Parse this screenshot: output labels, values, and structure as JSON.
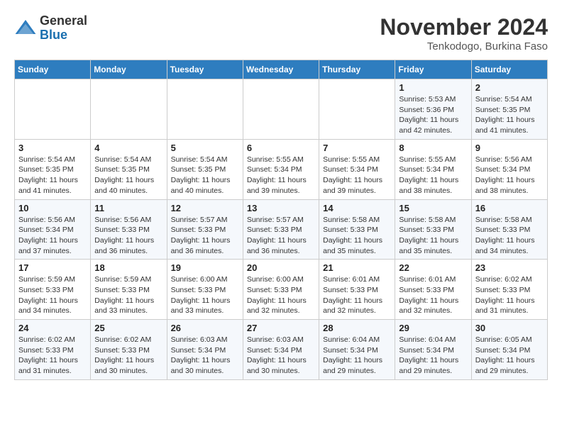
{
  "header": {
    "logo_general": "General",
    "logo_blue": "Blue",
    "month_title": "November 2024",
    "location": "Tenkodogo, Burkina Faso"
  },
  "weekdays": [
    "Sunday",
    "Monday",
    "Tuesday",
    "Wednesday",
    "Thursday",
    "Friday",
    "Saturday"
  ],
  "weeks": [
    [
      {
        "day": "",
        "info": ""
      },
      {
        "day": "",
        "info": ""
      },
      {
        "day": "",
        "info": ""
      },
      {
        "day": "",
        "info": ""
      },
      {
        "day": "",
        "info": ""
      },
      {
        "day": "1",
        "info": "Sunrise: 5:53 AM\nSunset: 5:36 PM\nDaylight: 11 hours\nand 42 minutes."
      },
      {
        "day": "2",
        "info": "Sunrise: 5:54 AM\nSunset: 5:35 PM\nDaylight: 11 hours\nand 41 minutes."
      }
    ],
    [
      {
        "day": "3",
        "info": "Sunrise: 5:54 AM\nSunset: 5:35 PM\nDaylight: 11 hours\nand 41 minutes."
      },
      {
        "day": "4",
        "info": "Sunrise: 5:54 AM\nSunset: 5:35 PM\nDaylight: 11 hours\nand 40 minutes."
      },
      {
        "day": "5",
        "info": "Sunrise: 5:54 AM\nSunset: 5:35 PM\nDaylight: 11 hours\nand 40 minutes."
      },
      {
        "day": "6",
        "info": "Sunrise: 5:55 AM\nSunset: 5:34 PM\nDaylight: 11 hours\nand 39 minutes."
      },
      {
        "day": "7",
        "info": "Sunrise: 5:55 AM\nSunset: 5:34 PM\nDaylight: 11 hours\nand 39 minutes."
      },
      {
        "day": "8",
        "info": "Sunrise: 5:55 AM\nSunset: 5:34 PM\nDaylight: 11 hours\nand 38 minutes."
      },
      {
        "day": "9",
        "info": "Sunrise: 5:56 AM\nSunset: 5:34 PM\nDaylight: 11 hours\nand 38 minutes."
      }
    ],
    [
      {
        "day": "10",
        "info": "Sunrise: 5:56 AM\nSunset: 5:34 PM\nDaylight: 11 hours\nand 37 minutes."
      },
      {
        "day": "11",
        "info": "Sunrise: 5:56 AM\nSunset: 5:33 PM\nDaylight: 11 hours\nand 36 minutes."
      },
      {
        "day": "12",
        "info": "Sunrise: 5:57 AM\nSunset: 5:33 PM\nDaylight: 11 hours\nand 36 minutes."
      },
      {
        "day": "13",
        "info": "Sunrise: 5:57 AM\nSunset: 5:33 PM\nDaylight: 11 hours\nand 36 minutes."
      },
      {
        "day": "14",
        "info": "Sunrise: 5:58 AM\nSunset: 5:33 PM\nDaylight: 11 hours\nand 35 minutes."
      },
      {
        "day": "15",
        "info": "Sunrise: 5:58 AM\nSunset: 5:33 PM\nDaylight: 11 hours\nand 35 minutes."
      },
      {
        "day": "16",
        "info": "Sunrise: 5:58 AM\nSunset: 5:33 PM\nDaylight: 11 hours\nand 34 minutes."
      }
    ],
    [
      {
        "day": "17",
        "info": "Sunrise: 5:59 AM\nSunset: 5:33 PM\nDaylight: 11 hours\nand 34 minutes."
      },
      {
        "day": "18",
        "info": "Sunrise: 5:59 AM\nSunset: 5:33 PM\nDaylight: 11 hours\nand 33 minutes."
      },
      {
        "day": "19",
        "info": "Sunrise: 6:00 AM\nSunset: 5:33 PM\nDaylight: 11 hours\nand 33 minutes."
      },
      {
        "day": "20",
        "info": "Sunrise: 6:00 AM\nSunset: 5:33 PM\nDaylight: 11 hours\nand 32 minutes."
      },
      {
        "day": "21",
        "info": "Sunrise: 6:01 AM\nSunset: 5:33 PM\nDaylight: 11 hours\nand 32 minutes."
      },
      {
        "day": "22",
        "info": "Sunrise: 6:01 AM\nSunset: 5:33 PM\nDaylight: 11 hours\nand 32 minutes."
      },
      {
        "day": "23",
        "info": "Sunrise: 6:02 AM\nSunset: 5:33 PM\nDaylight: 11 hours\nand 31 minutes."
      }
    ],
    [
      {
        "day": "24",
        "info": "Sunrise: 6:02 AM\nSunset: 5:33 PM\nDaylight: 11 hours\nand 31 minutes."
      },
      {
        "day": "25",
        "info": "Sunrise: 6:02 AM\nSunset: 5:33 PM\nDaylight: 11 hours\nand 30 minutes."
      },
      {
        "day": "26",
        "info": "Sunrise: 6:03 AM\nSunset: 5:34 PM\nDaylight: 11 hours\nand 30 minutes."
      },
      {
        "day": "27",
        "info": "Sunrise: 6:03 AM\nSunset: 5:34 PM\nDaylight: 11 hours\nand 30 minutes."
      },
      {
        "day": "28",
        "info": "Sunrise: 6:04 AM\nSunset: 5:34 PM\nDaylight: 11 hours\nand 29 minutes."
      },
      {
        "day": "29",
        "info": "Sunrise: 6:04 AM\nSunset: 5:34 PM\nDaylight: 11 hours\nand 29 minutes."
      },
      {
        "day": "30",
        "info": "Sunrise: 6:05 AM\nSunset: 5:34 PM\nDaylight: 11 hours\nand 29 minutes."
      }
    ]
  ]
}
